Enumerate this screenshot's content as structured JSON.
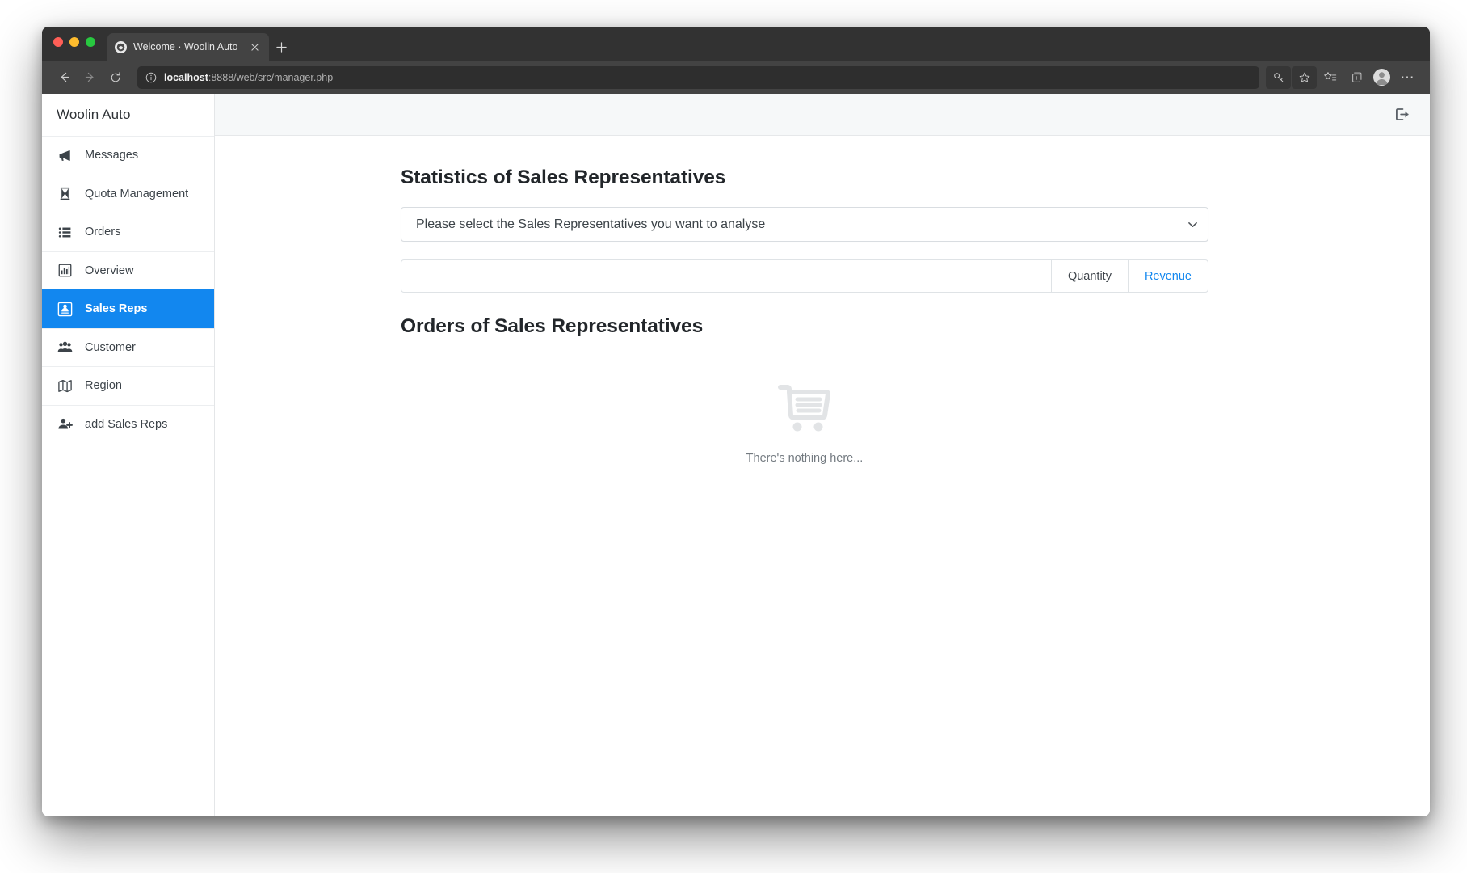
{
  "browser": {
    "tab": {
      "title": "Welcome · Woolin Auto",
      "favicon_icon": "site-favicon",
      "close_icon": "close-icon"
    },
    "new_tab_icon": "plus-icon",
    "back_icon": "back-arrow-icon",
    "forward_icon": "forward-arrow-icon",
    "reload_icon": "reload-icon",
    "site_info_icon": "info-circle-icon",
    "url_host": "localhost",
    "url_path": ":8888/web/src/manager.php",
    "toolbar_icons": [
      {
        "name": "key-icon"
      },
      {
        "name": "favorite-star-icon"
      },
      {
        "name": "favorites-list-icon"
      },
      {
        "name": "collections-icon"
      },
      {
        "name": "profile-avatar-icon"
      },
      {
        "name": "more-options-icon",
        "glyph": "⋯"
      }
    ]
  },
  "sidebar": {
    "brand": "Woolin Auto",
    "items": [
      {
        "label": "Messages",
        "icon": "megaphone-icon",
        "active": false
      },
      {
        "label": "Quota Management",
        "icon": "hourglass-icon",
        "active": false
      },
      {
        "label": "Orders",
        "icon": "list-icon",
        "active": false
      },
      {
        "label": "Overview",
        "icon": "bar-chart-icon",
        "active": false
      },
      {
        "label": "Sales Reps",
        "icon": "sales-rep-icon",
        "active": true
      },
      {
        "label": "Customer",
        "icon": "people-icon",
        "active": false
      },
      {
        "label": "Region",
        "icon": "map-icon",
        "active": false
      },
      {
        "label": "add Sales Reps",
        "icon": "person-add-icon",
        "active": false
      }
    ]
  },
  "topbar": {
    "logout_icon": "logout-icon"
  },
  "main": {
    "statistics_title": "Statistics of Sales Representatives",
    "select": {
      "value": "Please select the Sales Representatives you want to analyse",
      "chevron_icon": "chevron-down-icon"
    },
    "metric_tabs": [
      {
        "label": "Quantity",
        "active": true
      },
      {
        "label": "Revenue",
        "active": false
      }
    ],
    "orders_title": "Orders of Sales Representatives",
    "empty_state": {
      "icon": "shopping-cart-icon",
      "text": "There's nothing here..."
    }
  },
  "colors": {
    "accent": "#1287ef",
    "link": "#1287ef",
    "text": "#3c4349",
    "heading": "#22262a",
    "topbar_bg": "#f6f8f9"
  }
}
